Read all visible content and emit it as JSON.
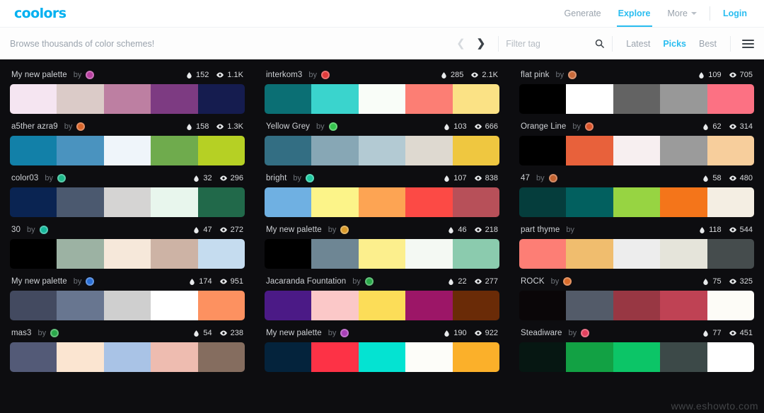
{
  "header": {
    "logo": "coolors",
    "nav": [
      {
        "label": "Generate",
        "active": false,
        "caret": false
      },
      {
        "label": "Explore",
        "active": true,
        "caret": false
      },
      {
        "label": "More",
        "active": false,
        "caret": true
      }
    ],
    "login_label": "Login"
  },
  "subbar": {
    "title": "Browse thousands of color schemes!",
    "prev_icon": "chevron-left-icon",
    "next_icon": "chevron-right-icon",
    "filter_placeholder": "Filter tag",
    "filter_value": "",
    "search_icon": "search-icon",
    "sorts": [
      {
        "label": "Latest",
        "active": false
      },
      {
        "label": "Picks",
        "active": true
      },
      {
        "label": "Best",
        "active": false
      }
    ],
    "menu_icon": "hamburger-menu-icon"
  },
  "stat_icons": {
    "likes": "water-drop-icon",
    "views": "eye-icon"
  },
  "by_label": "by",
  "watermark": "www.eshowto.com",
  "palettes": [
    {
      "name": "My new palette",
      "avatar": "#b83fa0",
      "likes": "152",
      "views": "1.1K",
      "colors": [
        "#f5e5f1",
        "#dbcbc8",
        "#bd7fa2",
        "#7d3b82",
        "#151c4f"
      ]
    },
    {
      "name": "interkom3",
      "avatar": "#e23b3b",
      "likes": "285",
      "views": "2.1K",
      "colors": [
        "#0b6f74",
        "#3ad4cd",
        "#f9fdf8",
        "#fc7e74",
        "#fbe285"
      ]
    },
    {
      "name": "flat pink",
      "avatar": "#c96a3a",
      "likes": "109",
      "views": "705",
      "colors": [
        "#000000",
        "#ffffff",
        "#636363",
        "#989898",
        "#fc7183"
      ]
    },
    {
      "name": "a5ther azra9",
      "avatar": "#d9662b",
      "likes": "158",
      "views": "1.3K",
      "colors": [
        "#1280a8",
        "#4a93bf",
        "#eff5fa",
        "#6fab4d",
        "#b6d024"
      ]
    },
    {
      "name": "Yellow Grey",
      "avatar": "#35c44d",
      "likes": "103",
      "views": "666",
      "colors": [
        "#336e83",
        "#87a7b5",
        "#b3cad3",
        "#ded9d0",
        "#efc740"
      ]
    },
    {
      "name": "Orange Line",
      "avatar": "#d9552b",
      "likes": "62",
      "views": "314",
      "colors": [
        "#000000",
        "#e8613b",
        "#f7eff0",
        "#9b9b9b",
        "#f7ce9c"
      ]
    },
    {
      "name": "color03",
      "avatar": "#1fb98b",
      "likes": "32",
      "views": "296",
      "colors": [
        "#0a2452",
        "#4b596f",
        "#d5d4d3",
        "#e8f6ed",
        "#21694a"
      ]
    },
    {
      "name": "bright",
      "avatar": "#1fc9a0",
      "likes": "107",
      "views": "838",
      "colors": [
        "#6fb0e2",
        "#fcf489",
        "#fda453",
        "#fc4a45",
        "#b75059"
      ]
    },
    {
      "name": "47",
      "avatar": "#c2622f",
      "likes": "58",
      "views": "480",
      "colors": [
        "#053d3c",
        "#02605f",
        "#97d442",
        "#f4751a",
        "#f4eee3"
      ]
    },
    {
      "name": "30",
      "avatar": "#16b89b",
      "likes": "47",
      "views": "272",
      "colors": [
        "#000000",
        "#9cb2a3",
        "#f6e8da",
        "#cdb3a5",
        "#c5dcef"
      ]
    },
    {
      "name": "My new palette",
      "avatar": "#d99a2b",
      "likes": "46",
      "views": "218",
      "colors": [
        "#000000",
        "#6e8694",
        "#fcef8d",
        "#f4f9f3",
        "#8bcbae"
      ]
    },
    {
      "name": "part thyme",
      "avatar": "",
      "likes": "118",
      "views": "544",
      "colors": [
        "#fd7e75",
        "#f0bd6e",
        "#ededed",
        "#e5e4da",
        "#454c4d"
      ]
    },
    {
      "name": "My new palette",
      "avatar": "#2a6fd6",
      "likes": "174",
      "views": "951",
      "colors": [
        "#434a60",
        "#687690",
        "#cfcfcf",
        "#ffffff",
        "#fd9160"
      ]
    },
    {
      "name": "Jacaranda Fountation",
      "avatar": "#2aa84a",
      "likes": "22",
      "views": "277",
      "colors": [
        "#4b1a86",
        "#fbc8c8",
        "#fcdd58",
        "#9c1667",
        "#6a2b07"
      ]
    },
    {
      "name": "ROCK",
      "avatar": "#d96c2b",
      "likes": "75",
      "views": "325",
      "colors": [
        "#0a0608",
        "#535b69",
        "#983743",
        "#bf4254",
        "#fdfcf7"
      ]
    },
    {
      "name": "mas3",
      "avatar": "#2aa84a",
      "likes": "54",
      "views": "238",
      "colors": [
        "#535a77",
        "#fbe5d1",
        "#a9c3e6",
        "#eebcb0",
        "#856d5f"
      ]
    },
    {
      "name": "My new palette",
      "avatar": "#a83fb8",
      "likes": "190",
      "views": "922",
      "colors": [
        "#04233c",
        "#fd3246",
        "#04e3d2",
        "#fdfdf9",
        "#fbb02a"
      ]
    },
    {
      "name": "Steadiware",
      "avatar": "#e2415e",
      "likes": "77",
      "views": "451",
      "colors": [
        "#061712",
        "#12a144",
        "#0cc567",
        "#3c4948",
        "#ffffff"
      ]
    }
  ]
}
